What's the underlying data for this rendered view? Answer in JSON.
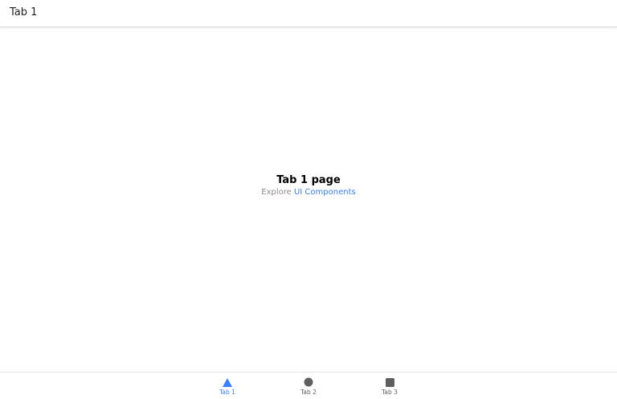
{
  "header": {
    "title": "Tab 1"
  },
  "main": {
    "heading": "Tab 1 page",
    "subtitle_prefix": "Explore ",
    "subtitle_link": "UI Components"
  },
  "tabbar": {
    "tabs": [
      {
        "label": "Tab 1",
        "icon": "triangle-icon",
        "active": true
      },
      {
        "label": "Tab 2",
        "icon": "circle-icon",
        "active": false
      },
      {
        "label": "Tab 3",
        "icon": "square-icon",
        "active": false
      }
    ]
  },
  "colors": {
    "accent": "#3880ff",
    "inactive": "#5f5f5f",
    "muted_text": "#8c8c8c"
  }
}
